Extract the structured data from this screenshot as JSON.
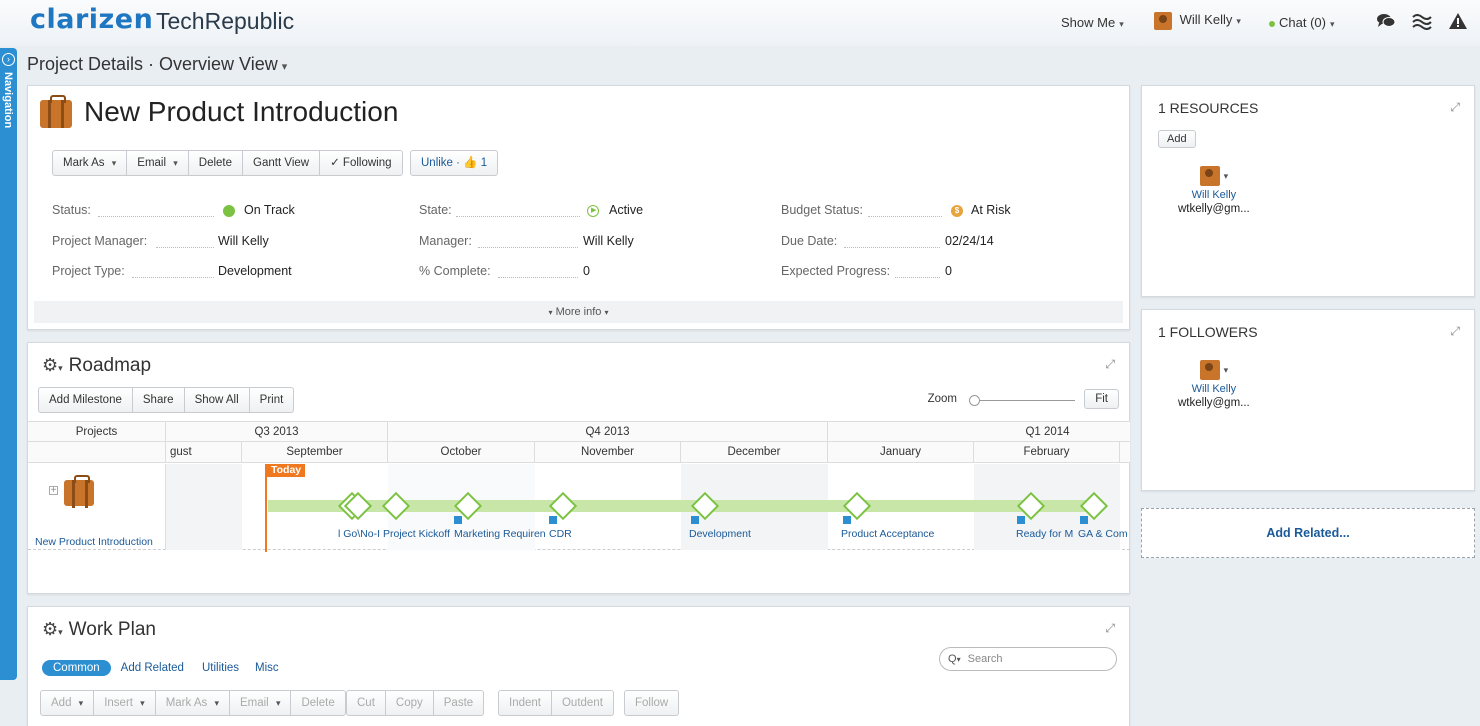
{
  "topbar": {
    "logo": "clarizen",
    "company": "TechRepublic",
    "show_me": "Show Me",
    "user": "Will Kelly",
    "chat": "Chat (0)"
  },
  "nav": {
    "label": "Navigation"
  },
  "breadcrumb": "Project Details · Overview View",
  "project": {
    "title": "New Product Introduction",
    "actions": [
      "Mark As",
      "Email",
      "Delete",
      "Gantt View",
      "Following"
    ],
    "unlike": "Unlike ·",
    "like_count": "1",
    "fields": {
      "status_label": "Status:",
      "status_value": "On Track",
      "state_label": "State:",
      "state_value": "Active",
      "budget_label": "Budget Status:",
      "budget_value": "At Risk",
      "pm_label": "Project Manager:",
      "pm_value": "Will Kelly",
      "manager_label": "Manager:",
      "manager_value": "Will Kelly",
      "due_label": "Due Date:",
      "due_value": "02/24/14",
      "type_label": "Project Type:",
      "type_value": "Development",
      "complete_label": "% Complete:",
      "complete_value": "0",
      "expected_label": "Expected Progress:",
      "expected_value": "0"
    },
    "more_info": "More info",
    "colors": {
      "on_track": "#7cc242",
      "active": "#7cc242",
      "at_risk": "#e8a33c"
    }
  },
  "roadmap": {
    "title": "Roadmap",
    "buttons": [
      "Add Milestone",
      "Share",
      "Show All",
      "Print"
    ],
    "zoom_label": "Zoom",
    "fit": "Fit",
    "projects_header": "Projects",
    "quarters": [
      "Q3 2013",
      "Q4 2013",
      "Q1 2014"
    ],
    "months": [
      "gust",
      "September",
      "October",
      "November",
      "December",
      "January",
      "February"
    ],
    "today": "Today",
    "row_name": "New Product Introduction",
    "milestones": [
      "l Go\\No-I",
      "Project Kickoff",
      "Marketing Requiren",
      "CDR",
      "Development",
      "Product Acceptance",
      "Ready for M",
      "GA & Com"
    ]
  },
  "workplan": {
    "title": "Work Plan",
    "tabs": [
      "Common",
      "Add Related",
      "Utilities",
      "Misc"
    ],
    "search_placeholder": "Search",
    "toolbar1": [
      "Add",
      "Insert",
      "Mark As",
      "Email",
      "Delete"
    ],
    "toolbar2": [
      "Cut",
      "Copy",
      "Paste"
    ],
    "toolbar3": [
      "Indent",
      "Outdent"
    ],
    "toolbar4": [
      "Follow"
    ]
  },
  "resources": {
    "title": "1 RESOURCES",
    "add": "Add",
    "name": "Will Kelly",
    "email": "wtkelly@gm..."
  },
  "followers": {
    "title": "1 FOLLOWERS",
    "name": "Will Kelly",
    "email": "wtkelly@gm..."
  },
  "add_related": "Add Related..."
}
